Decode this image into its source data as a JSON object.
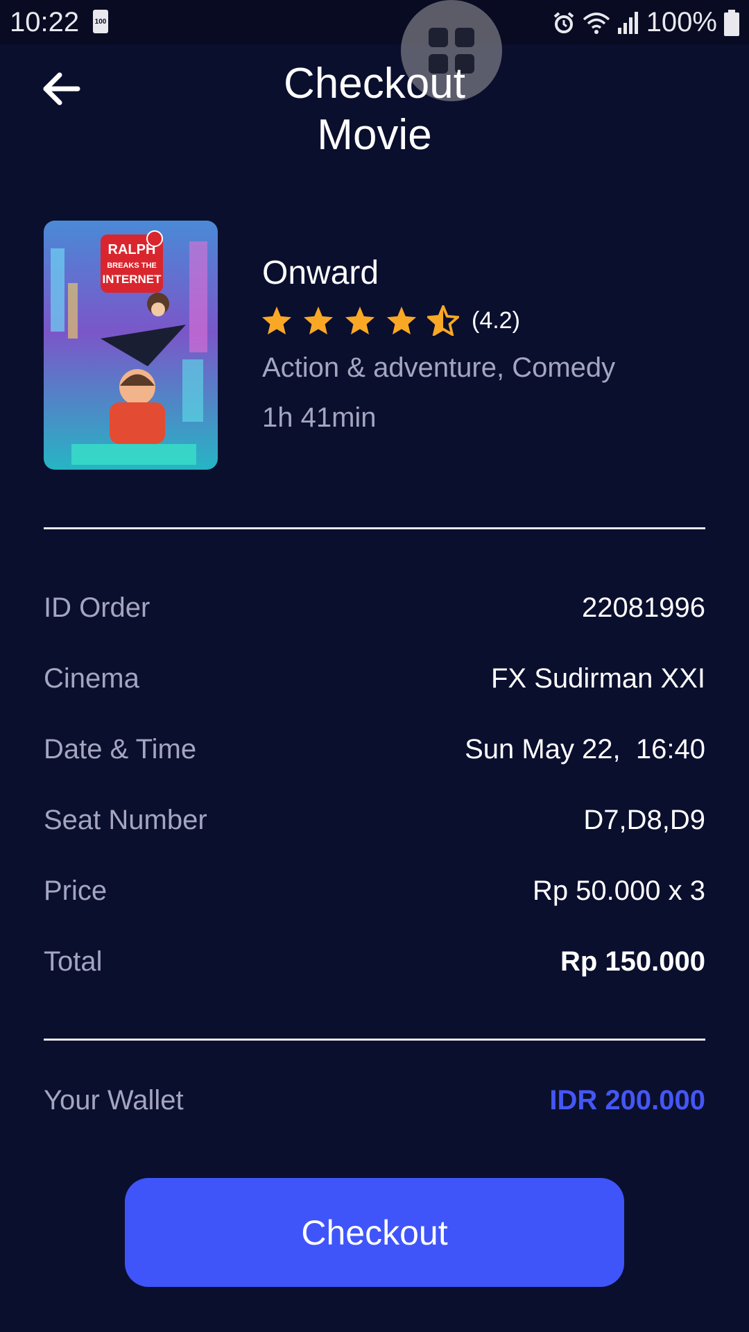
{
  "status_bar": {
    "time": "10:22",
    "battery_small": "100",
    "battery_percent": "100%"
  },
  "header": {
    "title_line1": "Checkout",
    "title_line2": "Movie"
  },
  "movie": {
    "title": "Onward",
    "rating": 4.2,
    "rating_text": "(4.2)",
    "genres": "Action & adventure, Comedy",
    "duration": "1h 41min",
    "poster_text": "RALPH BREAKS THE INTERNET"
  },
  "order": {
    "id_label": "ID Order",
    "id_value": "22081996",
    "cinema_label": "Cinema",
    "cinema_value": "FX Sudirman XXI",
    "datetime_label": "Date & Time",
    "datetime_value": "Sun May 22,  16:40",
    "seat_label": "Seat Number",
    "seat_value": "D7,D8,D9",
    "price_label": "Price",
    "price_value": "Rp 50.000 x 3",
    "total_label": "Total",
    "total_value": "Rp 150.000"
  },
  "wallet": {
    "label": "Your Wallet",
    "value": "IDR 200.000"
  },
  "checkout_label": "Checkout",
  "colors": {
    "background": "#0b0f2e",
    "accent": "#3f55fa",
    "star": "#f9a826",
    "muted_text": "#a4a6c0"
  }
}
